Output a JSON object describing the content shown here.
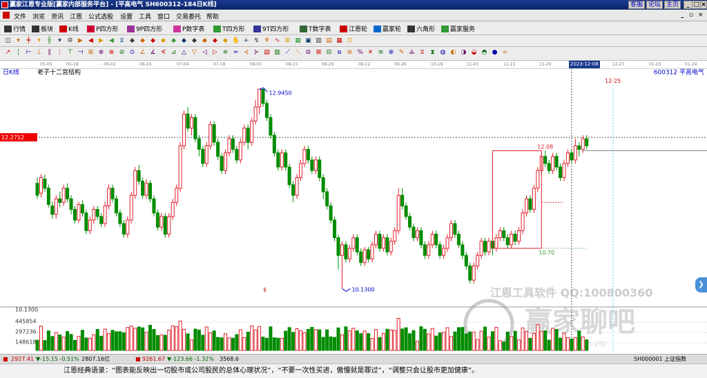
{
  "window": {
    "title": "赢家江恩专业版[赢家内部服务平台] - [平高电气  SH600312-184日K线]",
    "buttons": [
      "客服",
      "论坛",
      "主页"
    ],
    "controls": [
      "_",
      "□",
      "×"
    ],
    "mdi_controls": [
      "_",
      "▫",
      "×"
    ]
  },
  "menu": [
    "文件",
    "浏览",
    "资讯",
    "江恩",
    "公式选股",
    "设置",
    "工具",
    "窗口",
    "交易委托",
    "帮助"
  ],
  "toolbar1": [
    {
      "label": "行情",
      "icon": "grid-icon",
      "color": "#333"
    },
    {
      "label": "板块",
      "icon": "blocks-icon",
      "color": "#333"
    },
    {
      "label": "K线",
      "icon": "kline-icon",
      "color": "#c00"
    },
    {
      "label": "P四方形",
      "icon": "p-square-icon",
      "color": "#c03"
    },
    {
      "label": "9P四方形",
      "icon": "9p-square-icon",
      "color": "#939"
    },
    {
      "label": "P数字表",
      "icon": "p-table-icon",
      "color": "#c39"
    },
    {
      "label": "T四方形",
      "icon": "t-square-icon",
      "color": "#393"
    },
    {
      "label": "9T四方形",
      "icon": "9t-square-icon",
      "color": "#339"
    },
    {
      "label": "T数字表",
      "icon": "t-table-icon",
      "color": "#363"
    },
    {
      "label": "江恩轮",
      "icon": "gann-wheel-icon",
      "color": "#c00"
    },
    {
      "label": "赢家轮",
      "icon": "winner-wheel-icon",
      "color": "#06c"
    },
    {
      "label": "六角形",
      "icon": "hexagon-icon",
      "color": "#333"
    },
    {
      "label": "赢家服务",
      "icon": "service-icon",
      "color": "#393"
    }
  ],
  "chart_header": {
    "period": "日K线",
    "structure": "老子十二宫结构",
    "stock": "600312  平高电气",
    "cursor_date": "2023-12-08",
    "cursor_price": "12.2712",
    "future_date": "12-25"
  },
  "date_axis": [
    "05-05",
    "05-18",
    "06-02",
    "06-16",
    "07-04",
    "07-18",
    "08-01",
    "08-15",
    "08-29",
    "09-12",
    "09-26",
    "10-19",
    "11-01",
    "11-15",
    "11-29",
    "2023-12-08",
    "12-27",
    "01-10",
    "01-24"
  ],
  "annotations": {
    "high": "12.9450",
    "low": "10.1300",
    "box_top": "12.08",
    "box_bottom": "10.70",
    "dollar": "$"
  },
  "volume_axis": [
    "10.1300",
    "445854",
    "297236",
    "148618"
  ],
  "watermark": {
    "line1": "江恩工具软件  QQ:100800360",
    "line2": "赢家聊吧",
    "line3": "Jiaoba.vip"
  },
  "status": {
    "sh": "2927.41",
    "sh_chg": "▼-15.15 -0.51%",
    "sh_amt": "2807.16亿",
    "sz": "9261.67",
    "sz_chg": "▼-123.66 -1.32%",
    "sz_amt": "3568.6",
    "index_name": "SH000001 上证指数"
  },
  "quote": "江恩经典语录：“图表能反映出一切股市或公司股民的总体心理状况”，“不要一次性买进，傲慢就是罪过”，“调整只会让股市更加健康”。",
  "chart_data": {
    "type": "candlestick",
    "title": "老子十二宫结构",
    "symbol": "600312 平高电气",
    "period": "日K线",
    "ylim": [
      9.9,
      13.1
    ],
    "candles": [
      [
        11.62,
        11.45,
        11.7,
        11.4
      ],
      [
        11.48,
        11.7,
        11.75,
        11.42
      ],
      [
        11.68,
        11.55,
        11.74,
        11.5
      ],
      [
        11.55,
        11.32,
        11.6,
        11.28
      ],
      [
        11.3,
        11.18,
        11.36,
        11.12
      ],
      [
        11.18,
        11.4,
        11.45,
        11.12
      ],
      [
        11.4,
        11.35,
        11.5,
        11.28
      ],
      [
        11.35,
        11.55,
        11.6,
        11.3
      ],
      [
        11.55,
        11.4,
        11.62,
        11.35
      ],
      [
        11.4,
        11.25,
        11.45,
        11.18
      ],
      [
        11.25,
        11.1,
        11.3,
        11.05
      ],
      [
        11.1,
        11.32,
        11.36,
        11.06
      ],
      [
        11.32,
        11.2,
        11.38,
        11.15
      ],
      [
        11.2,
        10.95,
        11.25,
        10.9
      ],
      [
        10.95,
        11.1,
        11.15,
        10.9
      ],
      [
        11.1,
        11.25,
        11.3,
        11.05
      ],
      [
        11.25,
        11.15,
        11.3,
        11.1
      ],
      [
        11.15,
        11.05,
        11.2,
        11.0
      ],
      [
        11.05,
        11.3,
        11.36,
        11.0
      ],
      [
        11.3,
        11.55,
        11.6,
        11.25
      ],
      [
        11.55,
        11.4,
        11.6,
        11.35
      ],
      [
        11.4,
        11.2,
        11.45,
        11.15
      ],
      [
        11.2,
        11.05,
        11.25,
        11.0
      ],
      [
        11.05,
        10.9,
        11.1,
        10.85
      ],
      [
        10.9,
        11.1,
        11.15,
        10.85
      ],
      [
        11.1,
        11.45,
        11.5,
        11.05
      ],
      [
        11.45,
        11.8,
        11.85,
        11.4
      ],
      [
        11.8,
        11.65,
        11.88,
        11.6
      ],
      [
        11.65,
        11.45,
        11.7,
        11.4
      ],
      [
        11.45,
        11.62,
        11.68,
        11.4
      ],
      [
        11.62,
        11.4,
        11.66,
        11.35
      ],
      [
        11.4,
        11.2,
        11.45,
        11.15
      ],
      [
        11.2,
        11.0,
        11.25,
        10.95
      ],
      [
        11.0,
        11.15,
        11.2,
        10.95
      ],
      [
        11.15,
        10.9,
        11.2,
        10.85
      ],
      [
        10.9,
        11.15,
        11.2,
        10.85
      ],
      [
        11.15,
        11.35,
        11.4,
        11.1
      ],
      [
        11.35,
        11.55,
        11.6,
        11.3
      ],
      [
        11.55,
        12.15,
        12.2,
        11.5
      ],
      [
        12.15,
        12.6,
        12.65,
        12.1
      ],
      [
        12.6,
        12.4,
        12.7,
        12.35
      ],
      [
        12.4,
        12.55,
        12.6,
        12.3
      ],
      [
        12.55,
        12.25,
        12.6,
        12.2
      ],
      [
        12.25,
        12.1,
        12.3,
        12.0
      ],
      [
        12.1,
        11.9,
        12.15,
        11.85
      ],
      [
        11.9,
        12.15,
        12.2,
        11.85
      ],
      [
        12.15,
        12.45,
        12.5,
        12.1
      ],
      [
        12.45,
        12.2,
        12.5,
        12.15
      ],
      [
        12.2,
        12.0,
        12.25,
        11.95
      ],
      [
        12.0,
        11.8,
        12.05,
        11.75
      ],
      [
        11.8,
        12.05,
        12.1,
        11.75
      ],
      [
        12.05,
        12.25,
        12.3,
        12.0
      ],
      [
        12.25,
        12.1,
        12.3,
        12.05
      ],
      [
        12.1,
        11.95,
        12.15,
        11.9
      ],
      [
        11.95,
        12.2,
        12.25,
        11.9
      ],
      [
        12.2,
        12.4,
        12.45,
        12.15
      ],
      [
        12.4,
        12.2,
        12.45,
        12.1
      ],
      [
        12.2,
        12.5,
        12.55,
        12.15
      ],
      [
        12.5,
        12.7,
        12.8,
        12.45
      ],
      [
        12.7,
        12.95,
        12.95,
        12.6
      ],
      [
        12.95,
        12.75,
        12.95,
        12.7
      ],
      [
        12.75,
        12.55,
        12.8,
        12.5
      ],
      [
        12.55,
        12.3,
        12.6,
        12.25
      ],
      [
        12.3,
        12.05,
        12.35,
        12.0
      ],
      [
        12.05,
        11.85,
        12.1,
        11.8
      ],
      [
        11.85,
        12.05,
        12.1,
        11.8
      ],
      [
        12.05,
        11.85,
        12.1,
        11.8
      ],
      [
        11.85,
        11.6,
        11.9,
        11.55
      ],
      [
        11.6,
        11.45,
        11.65,
        11.35
      ],
      [
        11.45,
        11.7,
        11.75,
        11.4
      ],
      [
        11.7,
        11.9,
        11.95,
        11.65
      ],
      [
        11.9,
        12.1,
        12.15,
        11.85
      ],
      [
        12.1,
        11.95,
        12.15,
        11.9
      ],
      [
        11.95,
        11.8,
        12.0,
        11.75
      ],
      [
        11.8,
        11.95,
        12.0,
        11.75
      ],
      [
        11.95,
        11.7,
        12.0,
        11.65
      ],
      [
        11.7,
        11.5,
        11.75,
        11.4
      ],
      [
        11.5,
        11.3,
        11.55,
        11.25
      ],
      [
        11.3,
        11.1,
        11.35,
        11.05
      ],
      [
        11.1,
        10.85,
        11.15,
        10.8
      ],
      [
        10.85,
        10.6,
        10.9,
        10.4
      ],
      [
        10.6,
        10.75,
        10.8,
        10.13
      ],
      [
        10.75,
        10.55,
        10.8,
        10.5
      ],
      [
        10.55,
        10.7,
        10.75,
        10.5
      ],
      [
        10.7,
        10.85,
        10.9,
        10.65
      ],
      [
        10.85,
        10.65,
        10.9,
        10.6
      ],
      [
        10.65,
        10.5,
        10.7,
        10.45
      ],
      [
        10.5,
        10.68,
        10.72,
        10.45
      ],
      [
        10.68,
        10.55,
        10.72,
        10.5
      ],
      [
        10.55,
        10.75,
        10.8,
        10.5
      ],
      [
        10.75,
        10.9,
        10.95,
        10.7
      ],
      [
        10.9,
        10.7,
        10.95,
        10.65
      ],
      [
        10.7,
        10.85,
        10.9,
        10.65
      ],
      [
        10.85,
        10.65,
        10.9,
        10.6
      ],
      [
        10.65,
        10.8,
        10.85,
        10.6
      ],
      [
        10.8,
        10.95,
        11.0,
        10.75
      ],
      [
        10.95,
        11.45,
        11.55,
        10.9
      ],
      [
        11.45,
        11.3,
        11.55,
        11.25
      ],
      [
        11.3,
        11.15,
        11.35,
        11.1
      ],
      [
        11.15,
        11.0,
        11.2,
        10.95
      ],
      [
        11.0,
        10.85,
        11.05,
        10.8
      ],
      [
        10.85,
        10.95,
        11.0,
        10.8
      ],
      [
        10.95,
        10.75,
        11.0,
        10.7
      ],
      [
        10.75,
        10.6,
        10.8,
        10.55
      ],
      [
        10.6,
        10.75,
        10.8,
        10.55
      ],
      [
        10.75,
        10.9,
        10.95,
        10.7
      ],
      [
        10.9,
        10.75,
        10.95,
        10.7
      ],
      [
        10.75,
        10.6,
        10.8,
        10.55
      ],
      [
        10.6,
        10.7,
        10.75,
        10.55
      ],
      [
        10.7,
        10.85,
        10.9,
        10.65
      ],
      [
        10.85,
        11.05,
        11.1,
        10.8
      ],
      [
        11.05,
        10.9,
        11.1,
        10.85
      ],
      [
        10.9,
        10.75,
        10.95,
        10.7
      ],
      [
        10.75,
        10.6,
        10.8,
        10.55
      ],
      [
        10.6,
        10.45,
        10.65,
        10.4
      ],
      [
        10.45,
        10.25,
        10.5,
        10.2
      ],
      [
        10.25,
        10.45,
        10.5,
        10.2
      ],
      [
        10.45,
        10.6,
        10.65,
        10.4
      ],
      [
        10.6,
        10.8,
        10.85,
        10.55
      ],
      [
        10.8,
        10.65,
        10.85,
        10.6
      ],
      [
        10.65,
        10.8,
        10.85,
        10.6
      ],
      [
        10.8,
        10.7,
        10.85,
        10.6
      ],
      [
        10.7,
        10.85,
        10.9,
        10.65
      ],
      [
        10.85,
        10.95,
        11.0,
        10.8
      ],
      [
        10.95,
        10.85,
        11.0,
        10.8
      ],
      [
        10.85,
        10.75,
        10.9,
        10.7
      ],
      [
        10.75,
        10.9,
        10.95,
        10.7
      ],
      [
        10.9,
        10.8,
        10.95,
        10.75
      ],
      [
        10.8,
        10.95,
        11.0,
        10.75
      ],
      [
        10.95,
        11.2,
        11.25,
        10.9
      ],
      [
        11.2,
        11.4,
        11.45,
        11.15
      ],
      [
        11.4,
        11.25,
        11.45,
        11.2
      ],
      [
        11.25,
        11.55,
        11.6,
        11.2
      ],
      [
        11.55,
        11.8,
        11.85,
        11.5
      ],
      [
        11.8,
        12.0,
        12.05,
        11.75
      ],
      [
        12.0,
        11.9,
        12.08,
        11.85
      ],
      [
        11.9,
        11.8,
        11.95,
        11.75
      ],
      [
        11.8,
        12.0,
        12.05,
        11.75
      ],
      [
        12.0,
        11.85,
        12.05,
        11.8
      ],
      [
        11.85,
        11.7,
        11.9,
        11.65
      ],
      [
        11.7,
        11.9,
        11.95,
        11.65
      ],
      [
        11.9,
        12.05,
        12.1,
        11.85
      ],
      [
        12.05,
        11.95,
        12.1,
        11.9
      ],
      [
        11.95,
        12.15,
        12.25,
        11.9
      ],
      [
        12.15,
        12.1,
        12.2,
        12.0
      ],
      [
        12.1,
        12.25,
        12.3,
        12.05
      ],
      [
        12.25,
        12.15,
        12.3,
        12.1
      ]
    ]
  }
}
